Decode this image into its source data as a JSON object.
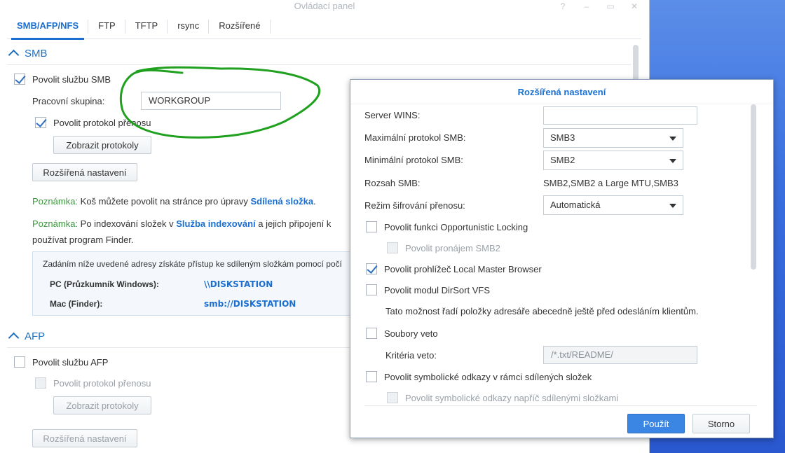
{
  "window": {
    "title": "Ovládací panel",
    "controls": [
      "?",
      "–",
      "▭",
      "✕"
    ]
  },
  "tabs": [
    {
      "label": "SMB/AFP/NFS",
      "active": true
    },
    {
      "label": "FTP"
    },
    {
      "label": "TFTP"
    },
    {
      "label": "rsync"
    },
    {
      "label": "Rozšířené"
    }
  ],
  "smb": {
    "header": "SMB",
    "enable_label": "Povolit službu SMB",
    "workgroup_label": "Pracovní skupina:",
    "workgroup_value": "WORKGROUP",
    "transfer_log_label": "Povolit protokol přenosu",
    "show_logs_button": "Zobrazit protokoly",
    "advanced_button": "Rozšířená nastavení",
    "note1": {
      "prefix": "Poznámka:",
      "text": " Koš můžete povolit na stránce pro úpravy ",
      "link": "Sdílená složka",
      "suffix": "."
    },
    "note2": {
      "prefix": "Poznámka:",
      "text": " Po indexování složek v ",
      "link": "Služba indexování",
      "suffix": " a jejich připojení k",
      "line2": "používat program Finder."
    },
    "info": {
      "text": "Zadáním níže uvedené adresy získáte přístup ke sdíleným složkám pomocí počí",
      "pc_label": "PC (Průzkumník Windows):",
      "pc_value": "\\\\DISKSTATION",
      "mac_label": "Mac (Finder):",
      "mac_value": "smb://DISKSTATION"
    }
  },
  "afp": {
    "header": "AFP",
    "enable_label": "Povolit službu AFP",
    "transfer_log_label": "Povolit protokol přenosu",
    "show_logs_button": "Zobrazit protokoly",
    "advanced_button": "Rozšířená nastavení"
  },
  "dialog": {
    "title": "Rozšířená nastavení",
    "wins_label": "Server WINS:",
    "wins_value": "",
    "max_label": "Maximální protokol SMB:",
    "max_value": "SMB3",
    "min_label": "Minimální protokol SMB:",
    "min_value": "SMB2",
    "range_label": "Rozsah SMB:",
    "range_value": "SMB2,SMB2 a Large MTU,SMB3",
    "enc_label": "Režim šifrování přenosu:",
    "enc_value": "Automatická",
    "oplock_label": "Povolit funkci Opportunistic Locking",
    "lease_label": "Povolit pronájem SMB2",
    "lmb_label": "Povolit prohlížeč Local Master Browser",
    "dirsort_label": "Povolit modul DirSort VFS",
    "dirsort_desc": "Tato možnost řadí položky adresáře abecedně ještě před odesláním klientům.",
    "veto_label": "Soubory veto",
    "veto_criteria_label": "Kritéria veto:",
    "veto_criteria_placeholder": "/*.txt/README/",
    "symlink_label": "Povolit symbolické odkazy v rámci sdílených složek",
    "symlink_cross_label": "Povolit symbolické odkazy napříč sdílenými složkami",
    "apply_button": "Použít",
    "cancel_button": "Storno"
  },
  "colors": {
    "accent": "#1a6fd1",
    "note_green": "#3a9a3a",
    "annotation": "#1fa01f"
  }
}
